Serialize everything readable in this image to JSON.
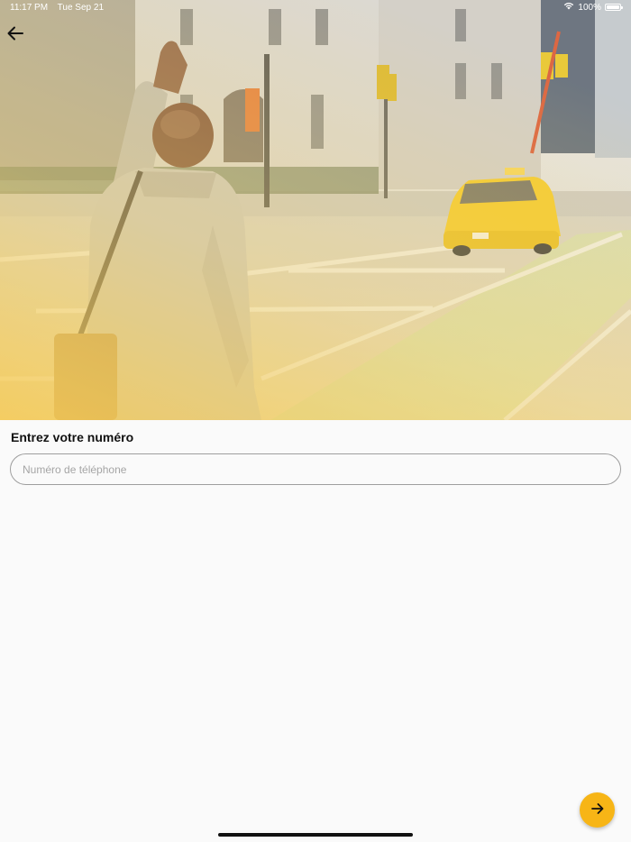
{
  "status_bar": {
    "time": "11:17 PM",
    "date": "Tue Sep 21",
    "battery": "100%"
  },
  "form": {
    "title": "Entrez votre numéro",
    "phone_placeholder": "Numéro de téléphone",
    "phone_value": ""
  },
  "icons": {
    "back": "arrow-left-icon",
    "next": "arrow-right-icon",
    "wifi": "wifi-icon",
    "battery": "battery-icon"
  },
  "colors": {
    "accent": "#f7b516",
    "background": "#fafafa",
    "text": "#111111",
    "input_border": "#9e9e9e"
  }
}
